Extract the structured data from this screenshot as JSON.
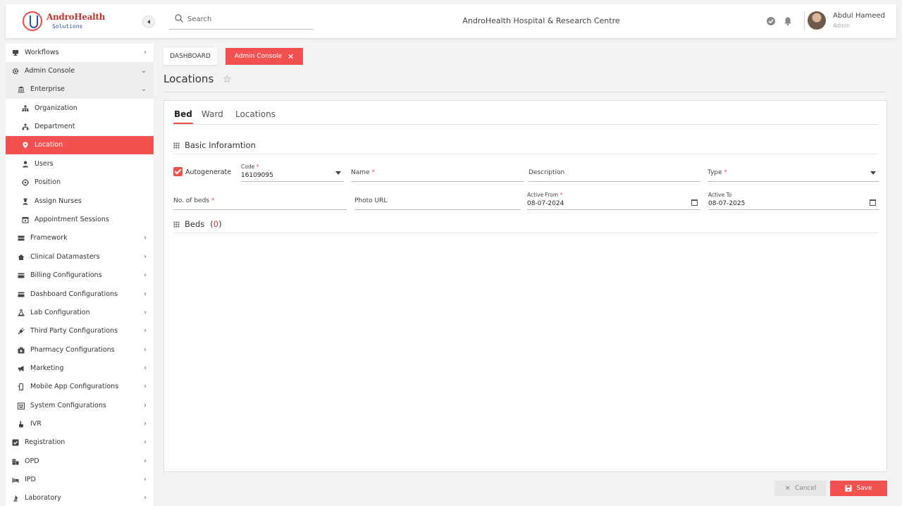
{
  "header": {
    "logo_name": "AndroHealth",
    "logo_sub": "Solutions",
    "search_placeholder": "Search",
    "hospital_title": "AndroHealth Hospital & Research Centre",
    "user_name": "Abdul Hameed",
    "user_role": "Admin"
  },
  "sidebar": {
    "items": [
      {
        "label": "Workflows",
        "icon": "desktop-icon"
      },
      {
        "label": "Admin Console",
        "icon": "gear-icon"
      },
      {
        "label": "Enterprise",
        "icon": "building-icon"
      },
      {
        "label": "Organization",
        "icon": "hierarchy-icon"
      },
      {
        "label": "Department",
        "icon": "branch-icon"
      },
      {
        "label": "Location",
        "icon": "location-pin-icon"
      },
      {
        "label": "Users",
        "icon": "user-icon"
      },
      {
        "label": "Position",
        "icon": "crosshair-icon"
      },
      {
        "label": "Assign Nurses",
        "icon": "nurse-icon"
      },
      {
        "label": "Appointment Sessions",
        "icon": "calendar-icon"
      },
      {
        "label": "Framework",
        "icon": "framework-icon"
      },
      {
        "label": "Clinical Datamasters",
        "icon": "home-icon"
      },
      {
        "label": "Billing Configurations",
        "icon": "card-icon"
      },
      {
        "label": "Dashboard Configurations",
        "icon": "card-icon"
      },
      {
        "label": "Lab Configuration",
        "icon": "flask-icon"
      },
      {
        "label": "Third Party Configurations",
        "icon": "plug-icon"
      },
      {
        "label": "Pharmacy Configurations",
        "icon": "medkit-icon"
      },
      {
        "label": "Marketing",
        "icon": "megaphone-icon"
      },
      {
        "label": "Mobile App Configurations",
        "icon": "mobile-icon"
      },
      {
        "label": "System Configurations",
        "icon": "system-icon"
      },
      {
        "label": "IVR",
        "icon": "hand-icon"
      },
      {
        "label": "Registration",
        "icon": "checkbox-icon"
      },
      {
        "label": "OPD",
        "icon": "opd-icon"
      },
      {
        "label": "IPD",
        "icon": "bed-icon"
      },
      {
        "label": "Laboratory",
        "icon": "lab-icon"
      }
    ]
  },
  "breadcrumbs": {
    "dashboard": "DASHBOARD",
    "admin_console": "Admin Console"
  },
  "page": {
    "title": "Locations"
  },
  "tabs": [
    "Bed",
    "Ward",
    "Locations"
  ],
  "form": {
    "section_basic": "Basic Inforamtion",
    "autogenerate_label": "Autogenerate",
    "code_label": "Code",
    "code_value": "16109095",
    "name_label": "Name",
    "description_label": "Description",
    "type_label": "Type",
    "beds_count_label": "No. of beds",
    "photo_url_label": "Photo URL",
    "active_from_label": "Active From",
    "active_from_value": "08-07-2024",
    "active_to_label": "Active To",
    "active_to_value": "08-07-2025",
    "required_mark": "*",
    "section_beds": "Beds",
    "beds_count_open": "(",
    "beds_count": "0",
    "beds_count_close": ")"
  },
  "actions": {
    "cancel": "Cancel",
    "save": "Save"
  },
  "colors": {
    "accent": "#f2514f",
    "logo_red": "#c43434",
    "logo_blue": "#2d4fa0"
  }
}
